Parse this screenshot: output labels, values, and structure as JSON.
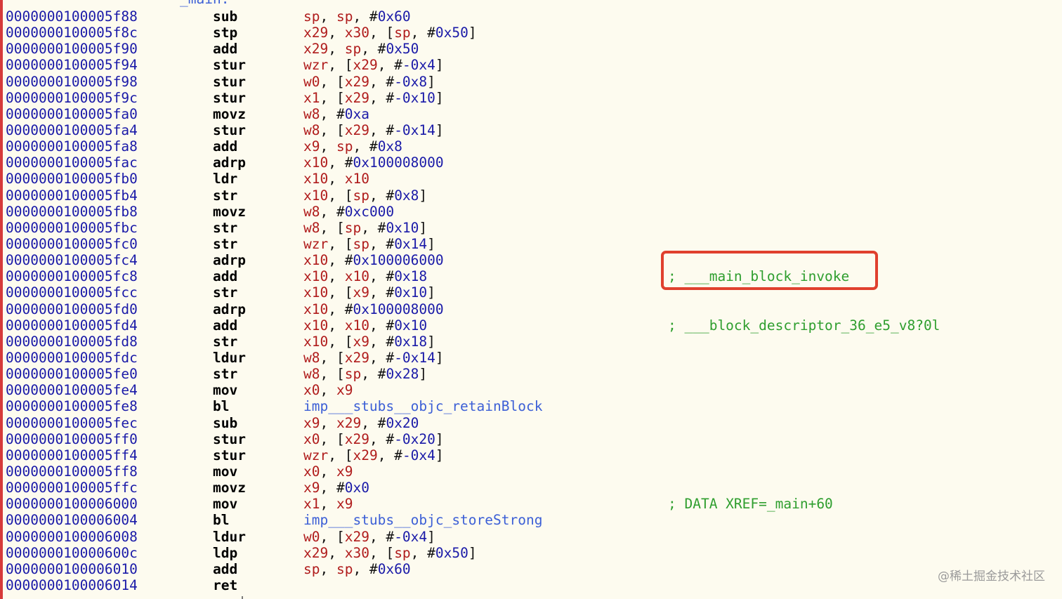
{
  "label": "_main:",
  "rows": [
    {
      "addr": "0000000100005f88",
      "mn": "sub",
      "ops": [
        [
          "r",
          "sp"
        ],
        [
          "p",
          ", "
        ],
        [
          "r",
          "sp"
        ],
        [
          "p",
          ", #"
        ],
        [
          "n",
          "0x60"
        ]
      ],
      "cmt": ""
    },
    {
      "addr": "0000000100005f8c",
      "mn": "stp",
      "ops": [
        [
          "r",
          "x29"
        ],
        [
          "p",
          ", "
        ],
        [
          "r",
          "x30"
        ],
        [
          "p",
          ", ["
        ],
        [
          "r",
          "sp"
        ],
        [
          "p",
          ", #"
        ],
        [
          "n",
          "0x50"
        ],
        [
          "p",
          "]"
        ]
      ],
      "cmt": ""
    },
    {
      "addr": "0000000100005f90",
      "mn": "add",
      "ops": [
        [
          "r",
          "x29"
        ],
        [
          "p",
          ", "
        ],
        [
          "r",
          "sp"
        ],
        [
          "p",
          ", #"
        ],
        [
          "n",
          "0x50"
        ]
      ],
      "cmt": ""
    },
    {
      "addr": "0000000100005f94",
      "mn": "stur",
      "ops": [
        [
          "r",
          "wzr"
        ],
        [
          "p",
          ", ["
        ],
        [
          "r",
          "x29"
        ],
        [
          "p",
          ", #"
        ],
        [
          "n",
          "-0x4"
        ],
        [
          "p",
          "]"
        ]
      ],
      "cmt": ""
    },
    {
      "addr": "0000000100005f98",
      "mn": "stur",
      "ops": [
        [
          "r",
          "w0"
        ],
        [
          "p",
          ", ["
        ],
        [
          "r",
          "x29"
        ],
        [
          "p",
          ", #"
        ],
        [
          "n",
          "-0x8"
        ],
        [
          "p",
          "]"
        ]
      ],
      "cmt": ""
    },
    {
      "addr": "0000000100005f9c",
      "mn": "stur",
      "ops": [
        [
          "r",
          "x1"
        ],
        [
          "p",
          ", ["
        ],
        [
          "r",
          "x29"
        ],
        [
          "p",
          ", #"
        ],
        [
          "n",
          "-0x10"
        ],
        [
          "p",
          "]"
        ]
      ],
      "cmt": ""
    },
    {
      "addr": "0000000100005fa0",
      "mn": "movz",
      "ops": [
        [
          "r",
          "w8"
        ],
        [
          "p",
          ", #"
        ],
        [
          "n",
          "0xa"
        ]
      ],
      "cmt": ""
    },
    {
      "addr": "0000000100005fa4",
      "mn": "stur",
      "ops": [
        [
          "r",
          "w8"
        ],
        [
          "p",
          ", ["
        ],
        [
          "r",
          "x29"
        ],
        [
          "p",
          ", #"
        ],
        [
          "n",
          "-0x14"
        ],
        [
          "p",
          "]"
        ]
      ],
      "cmt": ""
    },
    {
      "addr": "0000000100005fa8",
      "mn": "add",
      "ops": [
        [
          "r",
          "x9"
        ],
        [
          "p",
          ", "
        ],
        [
          "r",
          "sp"
        ],
        [
          "p",
          ", #"
        ],
        [
          "n",
          "0x8"
        ]
      ],
      "cmt": ""
    },
    {
      "addr": "0000000100005fac",
      "mn": "adrp",
      "ops": [
        [
          "r",
          "x10"
        ],
        [
          "p",
          ", #"
        ],
        [
          "n",
          "0x100008000"
        ]
      ],
      "cmt": ""
    },
    {
      "addr": "0000000100005fb0",
      "mn": "ldr",
      "ops": [
        [
          "r",
          "x10"
        ],
        [
          "p",
          ", "
        ],
        [
          "r",
          "x10"
        ]
      ],
      "cmt": ""
    },
    {
      "addr": "0000000100005fb4",
      "mn": "str",
      "ops": [
        [
          "r",
          "x10"
        ],
        [
          "p",
          ", ["
        ],
        [
          "r",
          "sp"
        ],
        [
          "p",
          ", #"
        ],
        [
          "n",
          "0x8"
        ],
        [
          "p",
          "]"
        ]
      ],
      "cmt": ""
    },
    {
      "addr": "0000000100005fb8",
      "mn": "movz",
      "ops": [
        [
          "r",
          "w8"
        ],
        [
          "p",
          ", #"
        ],
        [
          "n",
          "0xc000"
        ]
      ],
      "cmt": ""
    },
    {
      "addr": "0000000100005fbc",
      "mn": "str",
      "ops": [
        [
          "r",
          "w8"
        ],
        [
          "p",
          ", ["
        ],
        [
          "r",
          "sp"
        ],
        [
          "p",
          ", #"
        ],
        [
          "n",
          "0x10"
        ],
        [
          "p",
          "]"
        ]
      ],
      "cmt": ""
    },
    {
      "addr": "0000000100005fc0",
      "mn": "str",
      "ops": [
        [
          "r",
          "wzr"
        ],
        [
          "p",
          ", ["
        ],
        [
          "r",
          "sp"
        ],
        [
          "p",
          ", #"
        ],
        [
          "n",
          "0x14"
        ],
        [
          "p",
          "]"
        ]
      ],
      "cmt": ""
    },
    {
      "addr": "0000000100005fc4",
      "mn": "adrp",
      "ops": [
        [
          "r",
          "x10"
        ],
        [
          "p",
          ", #"
        ],
        [
          "n",
          "0x100006000"
        ]
      ],
      "cmt": ""
    },
    {
      "addr": "0000000100005fc8",
      "mn": "add",
      "ops": [
        [
          "r",
          "x10"
        ],
        [
          "p",
          ", "
        ],
        [
          "r",
          "x10"
        ],
        [
          "p",
          ", #"
        ],
        [
          "n",
          "0x18"
        ]
      ],
      "cmt": "; ___main_block_invoke"
    },
    {
      "addr": "0000000100005fcc",
      "mn": "str",
      "ops": [
        [
          "r",
          "x10"
        ],
        [
          "p",
          ", ["
        ],
        [
          "r",
          "x9"
        ],
        [
          "p",
          ", #"
        ],
        [
          "n",
          "0x10"
        ],
        [
          "p",
          "]"
        ]
      ],
      "cmt": ""
    },
    {
      "addr": "0000000100005fd0",
      "mn": "adrp",
      "ops": [
        [
          "r",
          "x10"
        ],
        [
          "p",
          ", #"
        ],
        [
          "n",
          "0x100008000"
        ]
      ],
      "cmt": ""
    },
    {
      "addr": "0000000100005fd4",
      "mn": "add",
      "ops": [
        [
          "r",
          "x10"
        ],
        [
          "p",
          ", "
        ],
        [
          "r",
          "x10"
        ],
        [
          "p",
          ", #"
        ],
        [
          "n",
          "0x10"
        ]
      ],
      "cmt": "; ___block_descriptor_36_e5_v8?0l"
    },
    {
      "addr": "0000000100005fd8",
      "mn": "str",
      "ops": [
        [
          "r",
          "x10"
        ],
        [
          "p",
          ", ["
        ],
        [
          "r",
          "x9"
        ],
        [
          "p",
          ", #"
        ],
        [
          "n",
          "0x18"
        ],
        [
          "p",
          "]"
        ]
      ],
      "cmt": ""
    },
    {
      "addr": "0000000100005fdc",
      "mn": "ldur",
      "ops": [
        [
          "r",
          "w8"
        ],
        [
          "p",
          ", ["
        ],
        [
          "r",
          "x29"
        ],
        [
          "p",
          ", #"
        ],
        [
          "n",
          "-0x14"
        ],
        [
          "p",
          "]"
        ]
      ],
      "cmt": ""
    },
    {
      "addr": "0000000100005fe0",
      "mn": "str",
      "ops": [
        [
          "r",
          "w8"
        ],
        [
          "p",
          ", ["
        ],
        [
          "r",
          "sp"
        ],
        [
          "p",
          ", #"
        ],
        [
          "n",
          "0x28"
        ],
        [
          "p",
          "]"
        ]
      ],
      "cmt": ""
    },
    {
      "addr": "0000000100005fe4",
      "mn": "mov",
      "ops": [
        [
          "r",
          "x0"
        ],
        [
          "p",
          ", "
        ],
        [
          "r",
          "x9"
        ]
      ],
      "cmt": ""
    },
    {
      "addr": "0000000100005fe8",
      "mn": "bl",
      "ops": [
        [
          "s",
          "imp___stubs__objc_retainBlock"
        ]
      ],
      "cmt": ""
    },
    {
      "addr": "0000000100005fec",
      "mn": "sub",
      "ops": [
        [
          "r",
          "x9"
        ],
        [
          "p",
          ", "
        ],
        [
          "r",
          "x29"
        ],
        [
          "p",
          ", #"
        ],
        [
          "n",
          "0x20"
        ]
      ],
      "cmt": ""
    },
    {
      "addr": "0000000100005ff0",
      "mn": "stur",
      "ops": [
        [
          "r",
          "x0"
        ],
        [
          "p",
          ", ["
        ],
        [
          "r",
          "x29"
        ],
        [
          "p",
          ", #"
        ],
        [
          "n",
          "-0x20"
        ],
        [
          "p",
          "]"
        ]
      ],
      "cmt": ""
    },
    {
      "addr": "0000000100005ff4",
      "mn": "stur",
      "ops": [
        [
          "r",
          "wzr"
        ],
        [
          "p",
          ", ["
        ],
        [
          "r",
          "x29"
        ],
        [
          "p",
          ", #"
        ],
        [
          "n",
          "-0x4"
        ],
        [
          "p",
          "]"
        ]
      ],
      "cmt": ""
    },
    {
      "addr": "0000000100005ff8",
      "mn": "mov",
      "ops": [
        [
          "r",
          "x0"
        ],
        [
          "p",
          ", "
        ],
        [
          "r",
          "x9"
        ]
      ],
      "cmt": ""
    },
    {
      "addr": "0000000100005ffc",
      "mn": "movz",
      "ops": [
        [
          "r",
          "x9"
        ],
        [
          "p",
          ", #"
        ],
        [
          "n",
          "0x0"
        ]
      ],
      "cmt": ""
    },
    {
      "addr": "0000000100006000",
      "mn": "mov",
      "ops": [
        [
          "r",
          "x1"
        ],
        [
          "p",
          ", "
        ],
        [
          "r",
          "x9"
        ]
      ],
      "cmt": "; DATA XREF=_main+60"
    },
    {
      "addr": "0000000100006004",
      "mn": "bl",
      "ops": [
        [
          "s",
          "imp___stubs__objc_storeStrong"
        ]
      ],
      "cmt": ""
    },
    {
      "addr": "0000000100006008",
      "mn": "ldur",
      "ops": [
        [
          "r",
          "w0"
        ],
        [
          "p",
          ", ["
        ],
        [
          "r",
          "x29"
        ],
        [
          "p",
          ", #"
        ],
        [
          "n",
          "-0x4"
        ],
        [
          "p",
          "]"
        ]
      ],
      "cmt": ""
    },
    {
      "addr": "000000010000600c",
      "mn": "ldp",
      "ops": [
        [
          "r",
          "x29"
        ],
        [
          "p",
          ", "
        ],
        [
          "r",
          "x30"
        ],
        [
          "p",
          ", ["
        ],
        [
          "r",
          "sp"
        ],
        [
          "p",
          ", #"
        ],
        [
          "n",
          "0x50"
        ],
        [
          "p",
          "]"
        ]
      ],
      "cmt": ""
    },
    {
      "addr": "0000000100006010",
      "mn": "add",
      "ops": [
        [
          "r",
          "sp"
        ],
        [
          "p",
          ", "
        ],
        [
          "r",
          "sp"
        ],
        [
          "p",
          ", #"
        ],
        [
          "n",
          "0x60"
        ]
      ],
      "cmt": ""
    },
    {
      "addr": "0000000100006014",
      "mn": "ret",
      "ops": [],
      "cmt": ""
    }
  ],
  "watermark": "@稀土掘金技术社区",
  "highlight_color": "#e0402e"
}
